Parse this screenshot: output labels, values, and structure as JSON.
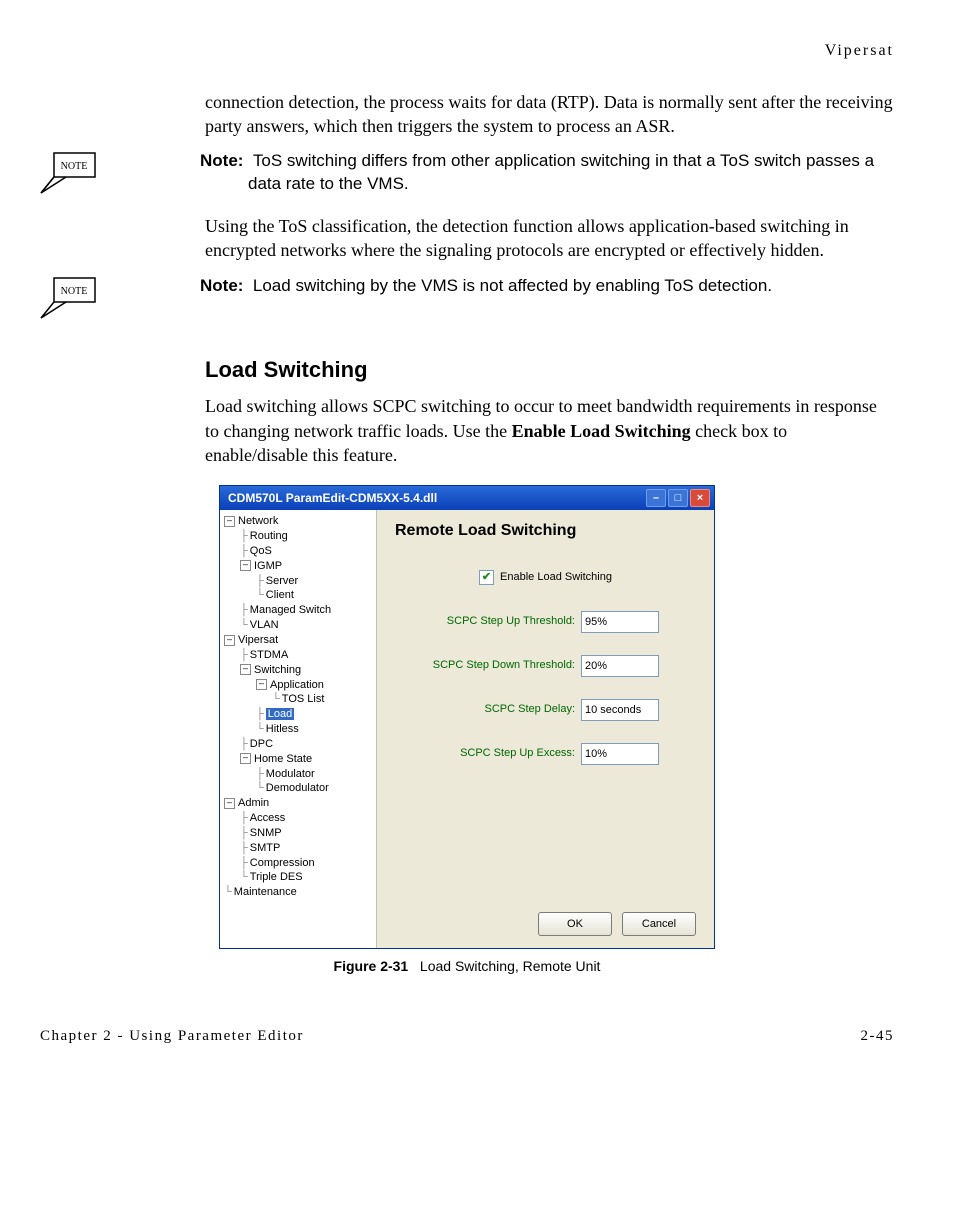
{
  "header": {
    "right": "Vipersat"
  },
  "p1": "connection detection, the process waits for data (RTP). Data is normally sent after the receiving party answers, which then triggers the system to process an ASR.",
  "noteIcon": "NOTE",
  "note1_label": "Note:",
  "note1": "Note: ToS switching differs from other application switching in that a ToS switch passes a data rate to the VMS.",
  "p2": "Using the ToS classification, the detection function allows application-based switching in encrypted networks where the signaling protocols are encrypted or effectively hidden.",
  "note2": "Note: Load switching by the VMS is not affected by enabling ToS detection.",
  "section": "Load Switching",
  "p3_a": "Load switching allows SCPC switching to occur to meet bandwidth requirements in response to changing network traffic loads. Use the ",
  "p3_b": "Enable Load Switching",
  "p3_c": " check box to enable/disable this feature.",
  "dialog": {
    "title": "CDM570L ParamEdit-CDM5XX-5.4.dll",
    "panelHead": "Remote Load Switching",
    "enableLabel": "Enable Load Switching",
    "fields": {
      "stepUpThreshold": {
        "label": "SCPC Step Up Threshold:",
        "value": "95%"
      },
      "stepDownThreshold": {
        "label": "SCPC Step Down Threshold:",
        "value": "20%"
      },
      "stepDelay": {
        "label": "SCPC Step Delay:",
        "value": "10 seconds"
      },
      "stepUpExcess": {
        "label": "SCPC Step Up Excess:",
        "value": "10%"
      }
    },
    "buttons": {
      "ok": "OK",
      "cancel": "Cancel"
    },
    "tree": {
      "network": "Network",
      "routing": "Routing",
      "qos": "QoS",
      "igmp": "IGMP",
      "server": "Server",
      "client": "Client",
      "managedSwitch": "Managed Switch",
      "vlan": "VLAN",
      "vipersat": "Vipersat",
      "stdma": "STDMA",
      "switching": "Switching",
      "application": "Application",
      "tosList": "TOS List",
      "load": "Load",
      "hitless": "Hitless",
      "dpc": "DPC",
      "homeState": "Home State",
      "modulator": "Modulator",
      "demodulator": "Demodulator",
      "admin": "Admin",
      "access": "Access",
      "snmp": "SNMP",
      "smtp": "SMTP",
      "compression": "Compression",
      "tripleDes": "Triple DES",
      "maintenance": "Maintenance"
    }
  },
  "chart_data": {
    "type": "table",
    "title": "Remote Load Switching settings",
    "rows": [
      {
        "field": "Enable Load Switching",
        "value": true
      },
      {
        "field": "SCPC Step Up Threshold",
        "value": "95%"
      },
      {
        "field": "SCPC Step Down Threshold",
        "value": "20%"
      },
      {
        "field": "SCPC Step Delay",
        "value": "10 seconds"
      },
      {
        "field": "SCPC Step Up Excess",
        "value": "10%"
      }
    ]
  },
  "figure": {
    "label": "Figure 2-31",
    "caption": "Load Switching, Remote Unit"
  },
  "footer": {
    "left": "Chapter 2 - Using Parameter Editor",
    "right": "2-45"
  }
}
